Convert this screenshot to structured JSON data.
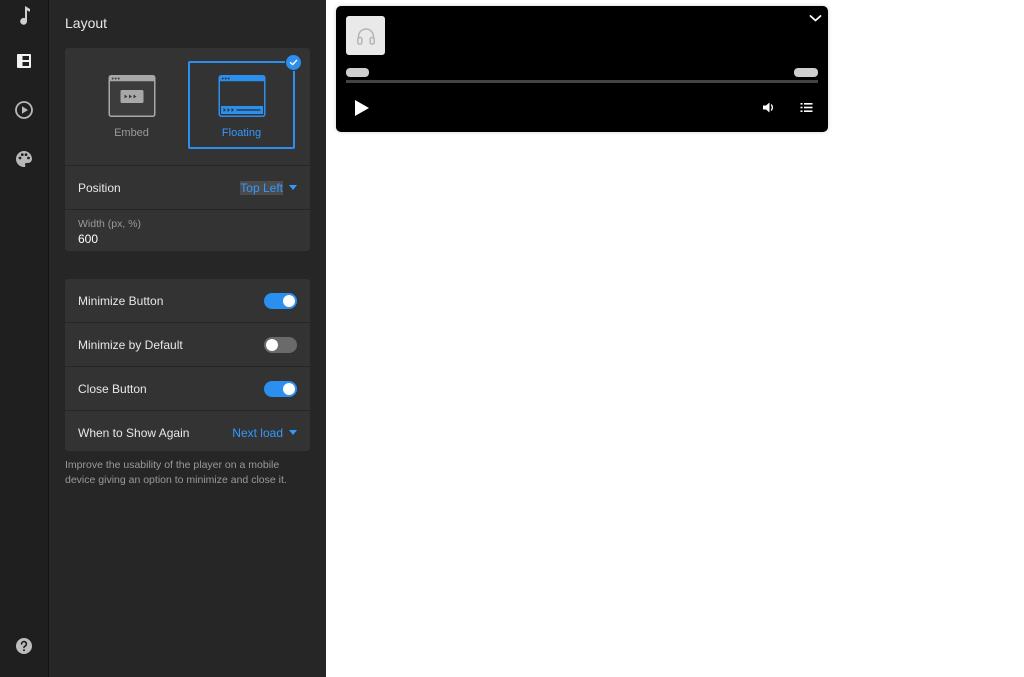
{
  "sidebar_nav": [
    {
      "icon": "music-note-icon"
    },
    {
      "icon": "layout-icon",
      "active": true
    },
    {
      "icon": "play-circle-icon"
    },
    {
      "icon": "palette-icon"
    }
  ],
  "help_icon": "help-circle-icon",
  "panel": {
    "title": "Layout",
    "layout_options": [
      {
        "label": "Embed",
        "selected": false
      },
      {
        "label": "Floating",
        "selected": true
      }
    ],
    "position": {
      "label": "Position",
      "value": "Top Left"
    },
    "width": {
      "label": "Width (px, %)",
      "value": "600"
    },
    "options": [
      {
        "label": "Minimize Button",
        "on": true
      },
      {
        "label": "Minimize by Default",
        "on": false
      },
      {
        "label": "Close Button",
        "on": true
      }
    ],
    "show_again": {
      "label": "When to Show Again",
      "value": "Next load"
    },
    "help_text": "Improve the usability of the player on a mobile device giving an option to minimize and close it."
  },
  "colors": {
    "accent": "#2b8ff0",
    "panel_bg": "#262626",
    "card_bg": "#333333",
    "rail_bg": "#1f1f1f",
    "player_bg": "#000000"
  },
  "player": {
    "artwork_icon": "headphones-icon",
    "progress": 0,
    "controls": [
      "chevron-down-icon",
      "play-icon",
      "volume-icon",
      "playlist-icon"
    ]
  }
}
